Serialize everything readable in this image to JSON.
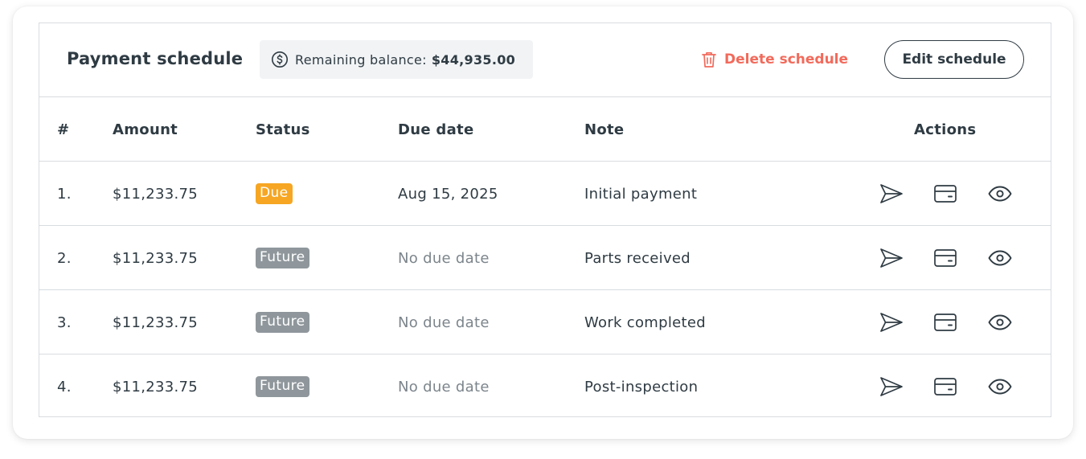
{
  "header": {
    "title": "Payment schedule",
    "balance_label": "Remaining balance:",
    "balance_amount": "$44,935.00",
    "delete_label": "Delete schedule",
    "edit_label": "Edit schedule"
  },
  "table": {
    "columns": {
      "num": "#",
      "amount": "Amount",
      "status": "Status",
      "due_date": "Due date",
      "note": "Note",
      "actions": "Actions"
    },
    "rows": [
      {
        "num": "1.",
        "amount": "$11,233.75",
        "status": "Due",
        "due_date": "Aug 15, 2025",
        "note": "Initial payment"
      },
      {
        "num": "2.",
        "amount": "$11,233.75",
        "status": "Future",
        "due_date": "No due date",
        "note": "Parts received"
      },
      {
        "num": "3.",
        "amount": "$11,233.75",
        "status": "Future",
        "due_date": "No due date",
        "note": "Work completed"
      },
      {
        "num": "4.",
        "amount": "$11,233.75",
        "status": "Future",
        "due_date": "No due date",
        "note": "Post-inspection"
      }
    ],
    "row_actions": [
      "send-icon",
      "credit-card-icon",
      "eye-icon"
    ]
  },
  "colors": {
    "text": "#2f3b43",
    "muted": "#7c858c",
    "danger": "#f26a5b",
    "due_badge": "#f6a623",
    "future_badge": "#8f979c",
    "border": "#d8dcdf",
    "balance_bg": "#f1f3f5"
  },
  "icons": {
    "balance": "dollar-circle-icon",
    "delete": "trash-icon"
  }
}
